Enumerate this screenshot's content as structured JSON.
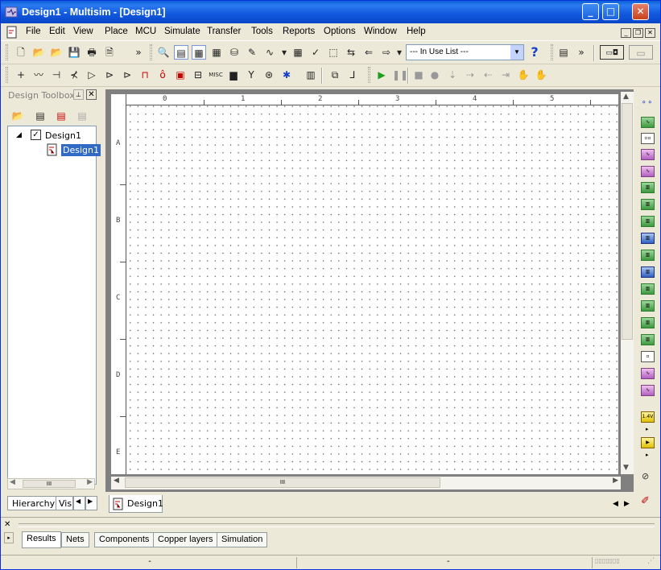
{
  "window": {
    "title": "Design1 - Multisim - [Design1]"
  },
  "menu": [
    "File",
    "Edit",
    "View",
    "Place",
    "MCU",
    "Simulate",
    "Transfer",
    "Tools",
    "Reports",
    "Options",
    "Window",
    "Help"
  ],
  "toolbar": {
    "in_use_list": "--- In Use List ---",
    "overflow": "»"
  },
  "design_toolbox": {
    "title": "Design Toolbox",
    "tree": {
      "root": "Design1",
      "child": "Design1"
    },
    "tabs": [
      "Hierarchy",
      "Vis"
    ]
  },
  "workspace": {
    "ruler_columns": [
      "0",
      "1",
      "2",
      "3",
      "4",
      "5"
    ],
    "ruler_rows": [
      "A",
      "B",
      "C",
      "D",
      "E"
    ],
    "doc_tab": "Design1"
  },
  "spreadsheet": {
    "tabs": [
      "Results",
      "Nets",
      "Components",
      "Copper layers",
      "Simulation"
    ],
    "active_tab": "Results"
  },
  "status": {
    "field1": "-",
    "field2": "-"
  },
  "colors": {
    "titlebar": "#0a5fd8",
    "selection": "#316ac5",
    "chrome": "#ece9d8"
  }
}
